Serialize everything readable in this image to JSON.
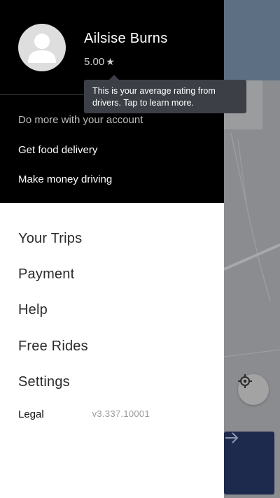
{
  "user": {
    "name": "Ailsise Burns",
    "rating": "5.00"
  },
  "tooltip": {
    "text_line1": "This is your average rating from",
    "text_line2": "drivers. Tap to learn more."
  },
  "account": {
    "heading": "Do more with your account",
    "links": [
      "Get food delivery",
      "Make money driving"
    ]
  },
  "menu": {
    "items": [
      "Your Trips",
      "Payment",
      "Help",
      "Free Rides",
      "Settings"
    ]
  },
  "footer": {
    "legal": "Legal",
    "version": "v3.337.10001"
  },
  "icons": {
    "avatar": "person-silhouette-icon",
    "rating_star": "star-icon",
    "locate": "crosshair-icon",
    "go": "arrow-right-icon"
  },
  "colors": {
    "header_bg": "#000000",
    "go_button": "#1d2a4e",
    "tooltip_bg": "#3c4046"
  }
}
